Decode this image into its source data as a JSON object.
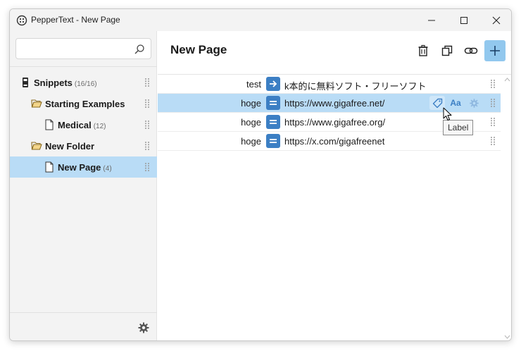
{
  "window": {
    "title": "PepperText - New Page"
  },
  "sidebar": {
    "search": {
      "value": "",
      "placeholder": ""
    },
    "tree": [
      {
        "label": "Snippets",
        "count": "(16/16)"
      },
      {
        "label": "Starting Examples",
        "count": ""
      },
      {
        "label": "Medical",
        "count": "(12)"
      },
      {
        "label": "New Folder",
        "count": ""
      },
      {
        "label": "New Page",
        "count": "(4)"
      }
    ]
  },
  "main": {
    "title": "New Page",
    "rows": [
      {
        "key": "test",
        "type": "arrow",
        "value": "k本的に無料ソフト・フリーソフト"
      },
      {
        "key": "hoge",
        "type": "equals",
        "value": "https://www.gigafree.net/"
      },
      {
        "key": "hoge",
        "type": "equals",
        "value": "https://www.gigafree.org/"
      },
      {
        "key": "hoge",
        "type": "equals",
        "value": "https://x.com/gigafreenet"
      }
    ],
    "row_actions": {
      "case_label": "Aa"
    },
    "tooltip": "Label"
  },
  "colors": {
    "accent": "#3c7fc4",
    "selection": "#b9dcf6",
    "add_button": "#92c8ee"
  }
}
